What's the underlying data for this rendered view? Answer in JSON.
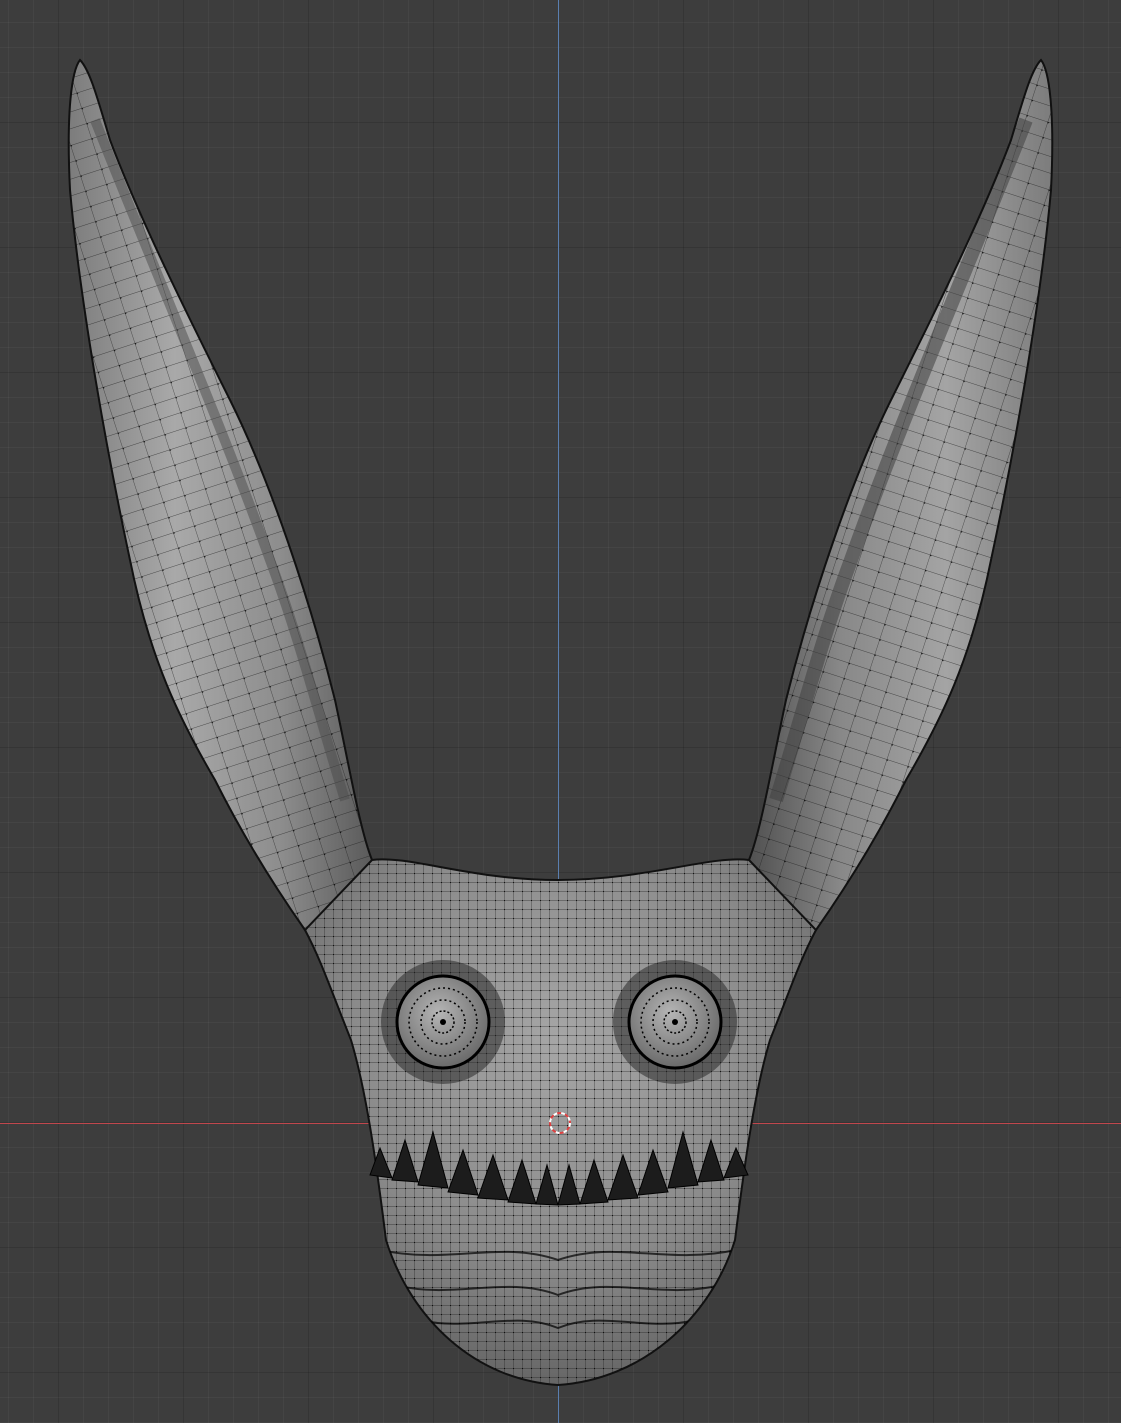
{
  "viewport": {
    "background": "#3d3d3d",
    "grid_color": "#333333",
    "x_axis_color": "#c0474d",
    "y_axis_color": "#5a7fb0"
  },
  "mesh": {
    "base_color": "#8a8a8a",
    "highlight_color": "#b9b9b9",
    "shadow_color": "#555555",
    "wire_color": "#1a1a1a",
    "vertex_color": "#000000"
  },
  "cursor_3d": {
    "ring_color_a": "#e04040",
    "ring_color_b": "#ffffff"
  }
}
